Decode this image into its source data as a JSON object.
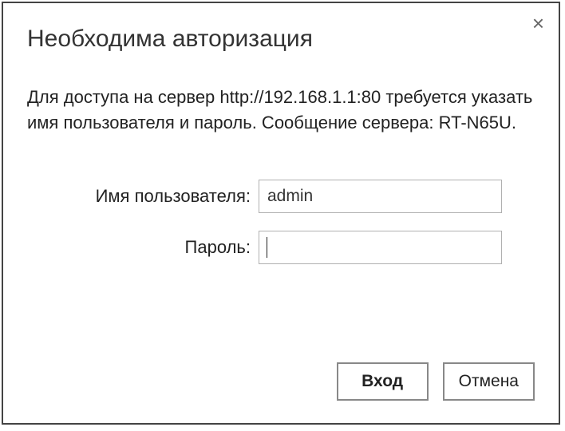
{
  "dialog": {
    "title": "Необходима авторизация",
    "message": "Для доступа на сервер http://192.168.1.1:80 требуется указать имя пользователя и пароль. Сообщение сервера: RT-N65U.",
    "close_glyph": "×",
    "fields": {
      "username": {
        "label": "Имя пользователя:",
        "value": "admin"
      },
      "password": {
        "label": "Пароль:",
        "value": ""
      }
    },
    "buttons": {
      "login": "Вход",
      "cancel": "Отмена"
    }
  }
}
